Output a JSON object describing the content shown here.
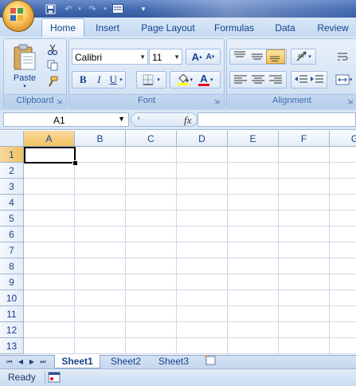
{
  "tabs": {
    "home": "Home",
    "insert": "Insert",
    "page_layout": "Page Layout",
    "formulas": "Formulas",
    "data": "Data",
    "review": "Review"
  },
  "clipboard": {
    "paste": "Paste",
    "group_label": "Clipboard"
  },
  "font": {
    "name": "Calibri",
    "size": "11",
    "group_label": "Font",
    "bold": "B",
    "italic": "I",
    "underline": "U",
    "grow": "A",
    "shrink": "A",
    "color_letter": "A"
  },
  "alignment": {
    "group_label": "Alignment"
  },
  "formula_bar": {
    "name_box": "A1",
    "fx": "fx",
    "formula": ""
  },
  "grid": {
    "columns": [
      "A",
      "B",
      "C",
      "D",
      "E",
      "F",
      "G"
    ],
    "rows": [
      "1",
      "2",
      "3",
      "4",
      "5",
      "6",
      "7",
      "8",
      "9",
      "10",
      "11",
      "12",
      "13"
    ],
    "active_cell": "A1"
  },
  "sheets": [
    "Sheet1",
    "Sheet2",
    "Sheet3"
  ],
  "status": {
    "text": "Ready"
  },
  "colors": {
    "accent": "#15428b",
    "selection": "#f1c15f",
    "font_color_bar": "#e8001c",
    "highlight_bar": "#ffff00"
  }
}
